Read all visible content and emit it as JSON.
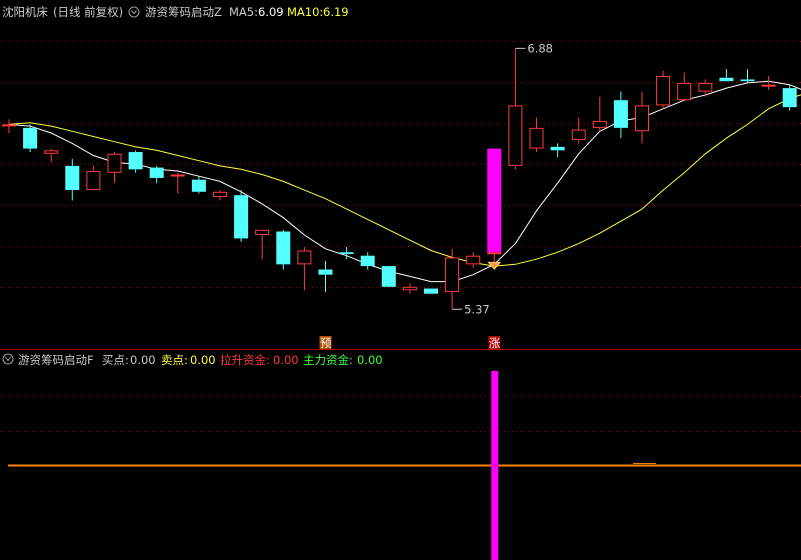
{
  "top_header": {
    "stock_name": "沈阳机床",
    "period": "(日线 前复权)",
    "indicator_name": "游资筹码启动Z",
    "ma5_label": "MA5:",
    "ma5_value": "6.09",
    "ma10_label": "MA10:",
    "ma10_value": "6.19"
  },
  "bottom_header": {
    "indicator_name": "游资筹码启动F",
    "buy_label": "买点:",
    "buy_value": "0.00",
    "sell_label": "卖点:",
    "sell_value": "0.00",
    "pull_label": "拉升资金:",
    "pull_value": "0.00",
    "main_label": "主力资金:",
    "main_value": "0.00"
  },
  "annotations": {
    "high": "6.88",
    "low": "5.37",
    "pre_marker": "预",
    "rise_marker": "涨"
  },
  "colors": {
    "up": "#ff3b3b",
    "down": "#54ffff",
    "ma5": "#ffffff",
    "ma10": "#ffff40",
    "signal": "#ff00ff",
    "baseline": "#ff7f00",
    "grid": "#8b0000",
    "header_text": "#c8c8c8"
  },
  "chart_data": [
    {
      "type": "candlestick",
      "title": "游资筹码启动Z",
      "ylim": [
        5.25,
        7.05
      ],
      "grid": true,
      "candles": [
        {
          "o": 6.43,
          "h": 6.47,
          "l": 6.39,
          "c": 6.44
        },
        {
          "o": 6.42,
          "h": 6.44,
          "l": 6.28,
          "c": 6.3
        },
        {
          "o": 6.27,
          "h": 6.3,
          "l": 6.22,
          "c": 6.29
        },
        {
          "o": 6.2,
          "h": 6.24,
          "l": 6.0,
          "c": 6.06
        },
        {
          "o": 6.06,
          "h": 6.2,
          "l": 6.06,
          "c": 6.17
        },
        {
          "o": 6.16,
          "h": 6.28,
          "l": 6.1,
          "c": 6.27
        },
        {
          "o": 6.28,
          "h": 6.29,
          "l": 6.16,
          "c": 6.18
        },
        {
          "o": 6.19,
          "h": 6.2,
          "l": 6.1,
          "c": 6.13
        },
        {
          "o": 6.14,
          "h": 6.16,
          "l": 6.04,
          "c": 6.15
        },
        {
          "o": 6.12,
          "h": 6.14,
          "l": 6.04,
          "c": 6.05
        },
        {
          "o": 6.02,
          "h": 6.06,
          "l": 6.0,
          "c": 6.05
        },
        {
          "o": 6.03,
          "h": 6.06,
          "l": 5.76,
          "c": 5.78
        },
        {
          "o": 5.8,
          "h": 5.82,
          "l": 5.66,
          "c": 5.83
        },
        {
          "o": 5.82,
          "h": 5.83,
          "l": 5.6,
          "c": 5.63
        },
        {
          "o": 5.63,
          "h": 5.73,
          "l": 5.48,
          "c": 5.71
        },
        {
          "o": 5.6,
          "h": 5.65,
          "l": 5.47,
          "c": 5.57
        },
        {
          "o": 5.7,
          "h": 5.73,
          "l": 5.66,
          "c": 5.69
        },
        {
          "o": 5.68,
          "h": 5.7,
          "l": 5.6,
          "c": 5.62
        },
        {
          "o": 5.62,
          "h": 5.62,
          "l": 5.51,
          "c": 5.5
        },
        {
          "o": 5.48,
          "h": 5.52,
          "l": 5.46,
          "c": 5.5
        },
        {
          "o": 5.49,
          "h": 5.49,
          "l": 5.46,
          "c": 5.46
        },
        {
          "o": 5.47,
          "h": 5.72,
          "l": 5.37,
          "c": 5.67
        },
        {
          "o": 5.63,
          "h": 5.7,
          "l": 5.61,
          "c": 5.68
        },
        {
          "o": 5.69,
          "h": 5.72,
          "l": 5.61,
          "c": 5.7
        },
        {
          "o": 6.2,
          "h": 6.88,
          "l": 6.18,
          "c": 6.55
        },
        {
          "o": 6.3,
          "h": 6.48,
          "l": 6.28,
          "c": 6.42
        },
        {
          "o": 6.31,
          "h": 6.33,
          "l": 6.25,
          "c": 6.29
        },
        {
          "o": 6.35,
          "h": 6.48,
          "l": 6.33,
          "c": 6.41
        },
        {
          "o": 6.42,
          "h": 6.6,
          "l": 6.4,
          "c": 6.46
        },
        {
          "o": 6.58,
          "h": 6.63,
          "l": 6.36,
          "c": 6.42
        },
        {
          "o": 6.4,
          "h": 6.63,
          "l": 6.33,
          "c": 6.55
        },
        {
          "o": 6.55,
          "h": 6.75,
          "l": 6.53,
          "c": 6.72
        },
        {
          "o": 6.58,
          "h": 6.74,
          "l": 6.58,
          "c": 6.68
        },
        {
          "o": 6.63,
          "h": 6.7,
          "l": 6.6,
          "c": 6.68
        },
        {
          "o": 6.71,
          "h": 6.76,
          "l": 6.7,
          "c": 6.69
        },
        {
          "o": 6.7,
          "h": 6.76,
          "l": 6.68,
          "c": 6.69
        },
        {
          "o": 6.67,
          "h": 6.72,
          "l": 6.64,
          "c": 6.67
        },
        {
          "o": 6.65,
          "h": 6.67,
          "l": 6.52,
          "c": 6.54
        },
        {
          "o": 6.61,
          "h": 6.63,
          "l": 6.52,
          "c": 6.56
        }
      ],
      "ma5": [
        6.44,
        6.43,
        6.39,
        6.33,
        6.26,
        6.22,
        6.21,
        6.18,
        6.17,
        6.14,
        6.11,
        6.05,
        5.98,
        5.9,
        5.8,
        5.72,
        5.68,
        5.63,
        5.59,
        5.56,
        5.53,
        5.53,
        5.57,
        5.63,
        5.75,
        5.94,
        6.1,
        6.27,
        6.4,
        6.46,
        6.48,
        6.53,
        6.58,
        6.61,
        6.65,
        6.68,
        6.69,
        6.67,
        6.62
      ],
      "ma10": [
        6.44,
        6.45,
        6.43,
        6.4,
        6.37,
        6.34,
        6.31,
        6.29,
        6.26,
        6.23,
        6.2,
        6.18,
        6.15,
        6.11,
        6.06,
        6.01,
        5.95,
        5.89,
        5.83,
        5.77,
        5.71,
        5.67,
        5.64,
        5.62,
        5.63,
        5.66,
        5.7,
        5.75,
        5.81,
        5.88,
        5.95,
        6.06,
        6.16,
        6.27,
        6.36,
        6.44,
        6.53,
        6.59,
        6.63
      ],
      "signal_bar": {
        "index": 23,
        "from": 5.7,
        "to": 6.3
      },
      "max_label": {
        "index": 24,
        "value": "6.88"
      },
      "min_label": {
        "index": 21,
        "value": "5.37"
      },
      "marker_pre": {
        "index": 15,
        "text": "预"
      },
      "marker_rise": {
        "index": 23,
        "text": "涨"
      }
    },
    {
      "type": "bar",
      "title": "游资筹码启动F",
      "series": [
        {
          "name": "买点",
          "values": [
            0
          ]
        },
        {
          "name": "卖点",
          "values": [
            0
          ]
        },
        {
          "name": "拉升资金",
          "values": [
            0
          ]
        },
        {
          "name": "主力资金",
          "values": [
            0
          ]
        }
      ],
      "signal_index": 23
    }
  ]
}
